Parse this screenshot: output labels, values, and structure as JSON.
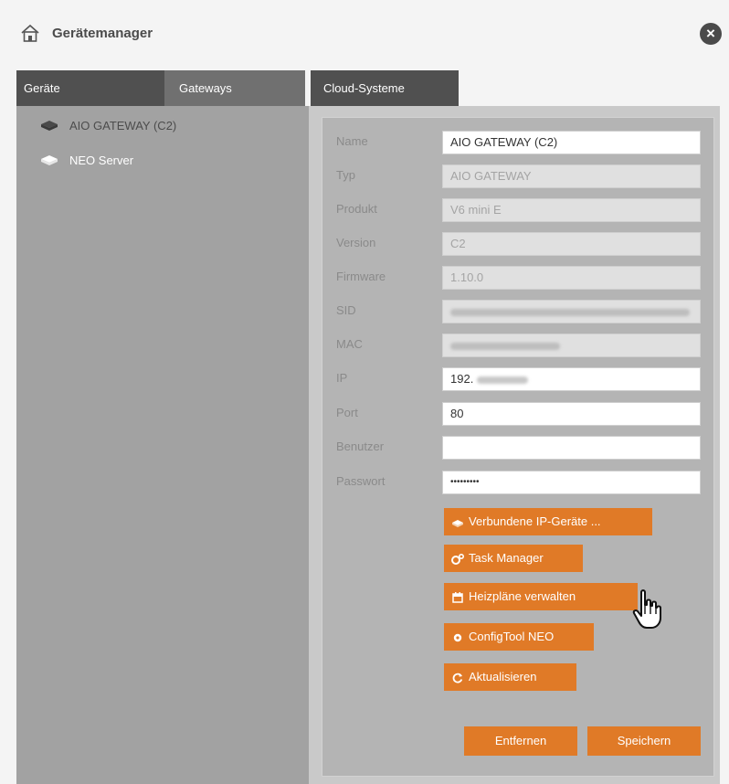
{
  "window": {
    "title": "Gerätemanager",
    "close_label": "×"
  },
  "tabs": [
    {
      "label": "Geräte",
      "active": false
    },
    {
      "label": "Gateways",
      "active": true
    },
    {
      "label": "Cloud-Systeme",
      "active": false
    }
  ],
  "gateways": [
    {
      "label": "AIO GATEWAY (C2)",
      "selected": false
    },
    {
      "label": "NEO Server",
      "selected": true
    }
  ],
  "fields": {
    "name": {
      "label": "Name",
      "value": "AIO GATEWAY (C2)"
    },
    "typ": {
      "label": "Typ",
      "value": "AIO GATEWAY"
    },
    "produkt": {
      "label": "Produkt",
      "value": "V6 mini E"
    },
    "version": {
      "label": "Version",
      "value": "C2"
    },
    "firmware": {
      "label": "Firmware",
      "value": "1.10.0"
    },
    "sid": {
      "label": "SID"
    },
    "mac": {
      "label": "MAC"
    },
    "ip": {
      "label": "IP",
      "value": "192."
    },
    "port": {
      "label": "Port",
      "value": "80"
    },
    "benutzer": {
      "label": "Benutzer",
      "value": ""
    },
    "passwort": {
      "label": "Passwort",
      "value": "•••••••••"
    }
  },
  "actions": {
    "connected_devices": "Verbundene IP-Geräte ...",
    "task_manager": "Task Manager",
    "heating_schedules": "Heizpläne verwalten",
    "configtool": "ConfigTool NEO",
    "refresh": "Aktualisieren"
  },
  "footer": {
    "remove": "Entfernen",
    "save": "Speichern"
  },
  "colors": {
    "accent": "#e07a27",
    "tab_dark": "#505050",
    "tab_active": "#707070",
    "left_panel": "#a2a2a2",
    "right_panel": "#c9c9c9"
  },
  "icons": [
    "house-icon",
    "close-icon",
    "gateway-icon",
    "server-icon",
    "cogs-icon",
    "calendar-icon",
    "gear-icon",
    "refresh-icon",
    "hand-cursor-icon"
  ]
}
